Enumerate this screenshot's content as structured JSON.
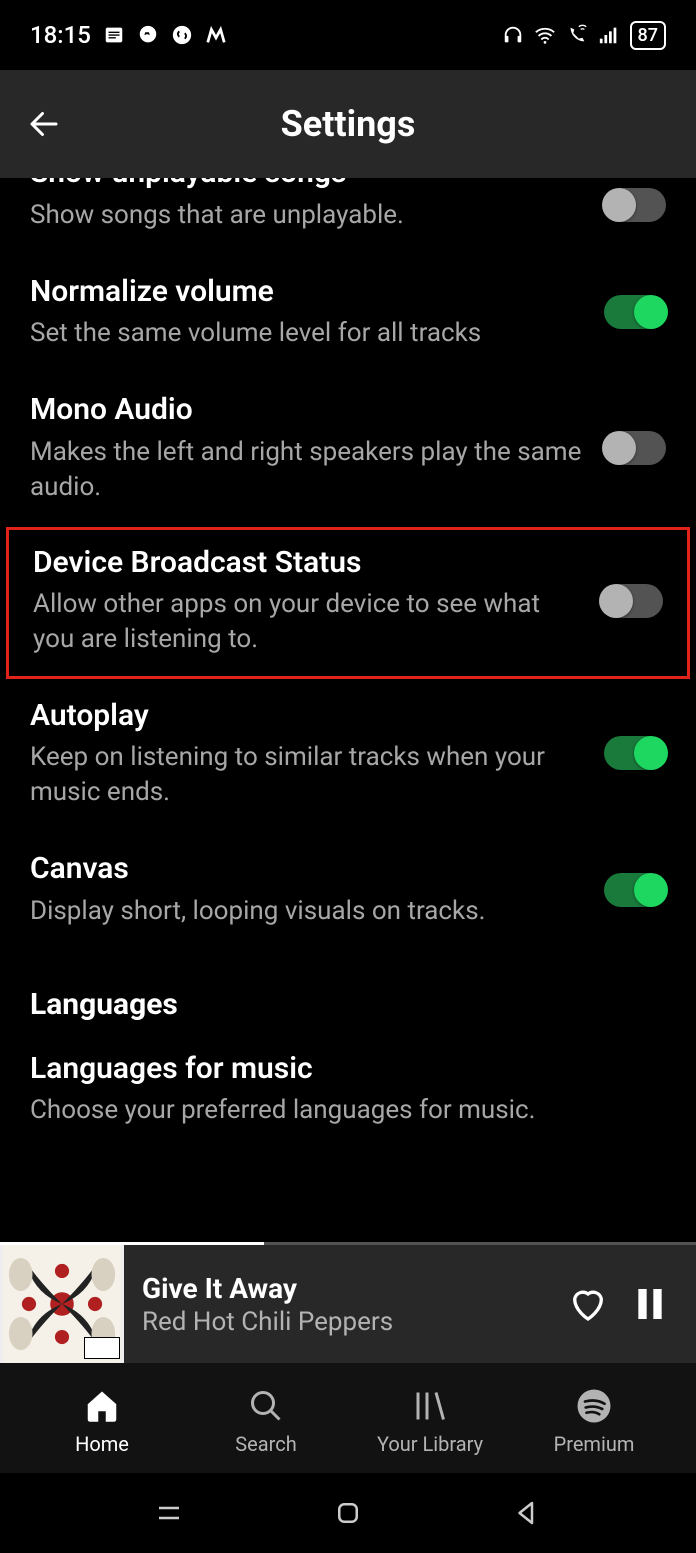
{
  "status": {
    "time": "18:15",
    "battery": "87"
  },
  "header": {
    "title": "Settings"
  },
  "settings": [
    {
      "title": "Show unplayable songs",
      "desc": "Show songs that are unplayable.",
      "on": false,
      "cut": true
    },
    {
      "title": "Normalize volume",
      "desc": "Set the same volume level for all tracks",
      "on": true
    },
    {
      "title": "Mono Audio",
      "desc": "Makes the left and right speakers play the same audio.",
      "on": false
    },
    {
      "title": "Device Broadcast Status",
      "desc": "Allow other apps on your device to see what you are listening to.",
      "on": false,
      "highlighted": true
    },
    {
      "title": "Autoplay",
      "desc": "Keep on listening to similar tracks when your music ends.",
      "on": true
    },
    {
      "title": "Canvas",
      "desc": "Display short, looping visuals on tracks.",
      "on": true
    }
  ],
  "section_languages": "Languages",
  "languages_for_music": {
    "title": "Languages for music",
    "desc": "Choose your preferred languages for music."
  },
  "now_playing": {
    "title": "Give It Away",
    "artist": "Red Hot Chili Peppers"
  },
  "nav": {
    "home": "Home",
    "search": "Search",
    "library": "Your Library",
    "premium": "Premium"
  }
}
